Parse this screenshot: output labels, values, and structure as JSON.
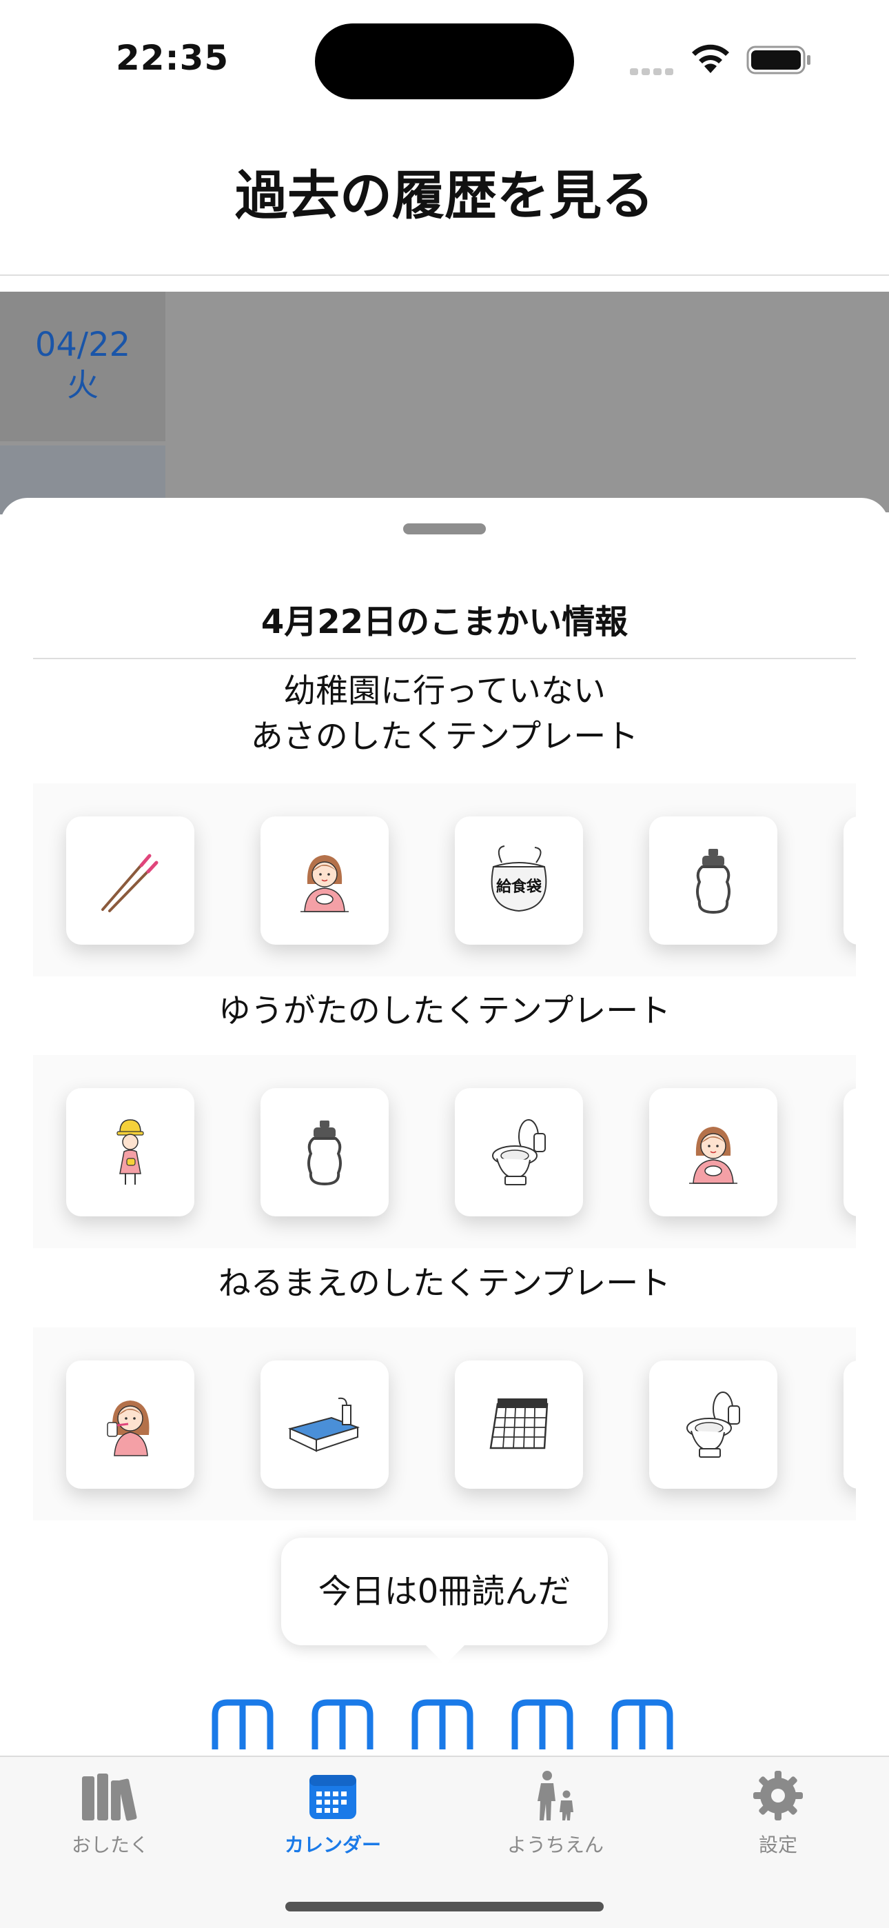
{
  "status_bar": {
    "time": "22:35"
  },
  "header": {
    "title": "過去の履歴を見る"
  },
  "calendar": {
    "date": "04/22",
    "weekday": "火"
  },
  "sheet": {
    "title": "4月22日のこまかい情報",
    "sections": [
      {
        "title_line1": "幼稚園に行っていない",
        "title_line2": "あさのしたくテンプレート",
        "icons": [
          "chopsticks-icon",
          "girl-eating-icon",
          "lunch-bag-icon",
          "water-bottle-icon"
        ],
        "icon_label": "給食袋"
      },
      {
        "title": "ゆうがたのしたくテンプレート",
        "icons": [
          "kindergarten-child-icon",
          "water-bottle-icon",
          "toilet-icon",
          "girl-eating-icon"
        ]
      },
      {
        "title": "ねるまえのしたくテンプレート",
        "icons": [
          "brushing-teeth-icon",
          "bathtub-icon",
          "calendar-icon",
          "toilet-icon"
        ]
      }
    ],
    "reading_bubble": "今日は0冊読んだ",
    "books_read": 0
  },
  "tab_bar": {
    "items": [
      {
        "label": "おしたく",
        "icon": "books-icon"
      },
      {
        "label": "カレンダー",
        "icon": "calendar-icon"
      },
      {
        "label": "ようちえん",
        "icon": "parent-child-icon"
      },
      {
        "label": "設定",
        "icon": "gear-icon"
      }
    ],
    "active": "カレンダー",
    "active_color": "#1a7ae8",
    "inactive_color": "#8a8a8a"
  }
}
